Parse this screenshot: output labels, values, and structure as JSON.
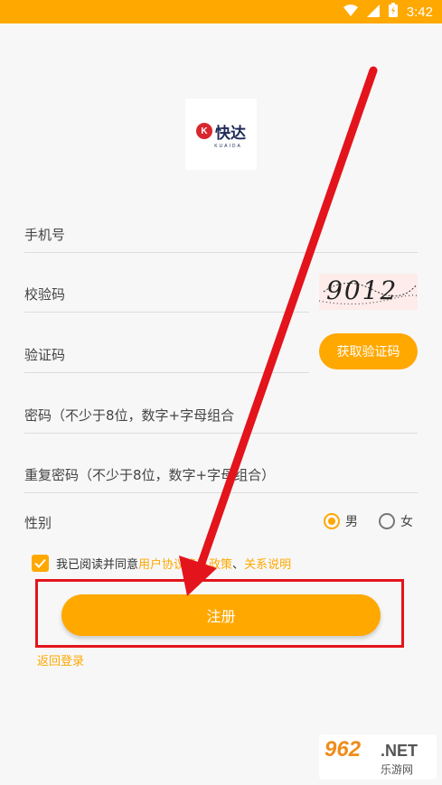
{
  "status_bar": {
    "time": "3:42",
    "icons": [
      "wifi-icon",
      "signal-icon",
      "battery-icon"
    ]
  },
  "logo": {
    "text": "快达",
    "mark": "K",
    "sub": "KUAIDA"
  },
  "form": {
    "phone": {
      "label": "手机号"
    },
    "captcha": {
      "label": "校验码",
      "image_text": "9012"
    },
    "verify": {
      "label": "验证码",
      "button": "获取验证码"
    },
    "password": {
      "label": "密码（不少于8位，数字+字母组合"
    },
    "repeat_password": {
      "label": "重复密码（不少于8位，数字+字母组合）"
    },
    "gender": {
      "label": "性别",
      "male": "男",
      "female": "女",
      "selected": "男"
    }
  },
  "agreement": {
    "checked": true,
    "prefix": "我已阅读并同意",
    "user_agreement": "用户协议",
    "privacy_policy": "隐私政策",
    "separator": "、",
    "relation": "关系说明"
  },
  "actions": {
    "register": "注册",
    "back_login": "返回登录"
  },
  "watermark": {
    "main": "962",
    "net": ".NET",
    "sub": "乐游网"
  },
  "colors": {
    "accent": "#ffa800",
    "annotation_red": "#e3141c"
  }
}
